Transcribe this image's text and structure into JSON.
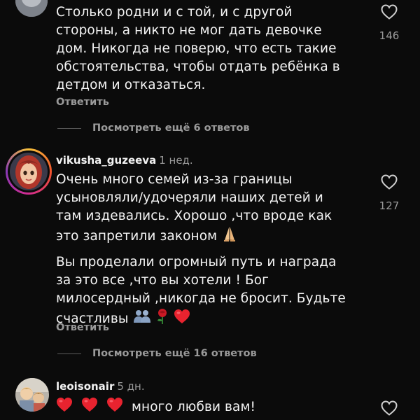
{
  "comments": [
    {
      "lines": [
        "Столько родни и с той, и с другой",
        "стороны, а никто не мог дать девочке",
        "дом. Никогда не поверю, что есть такие",
        "обстоятельства, чтобы отдать ребёнка в",
        "детдом и отказаться."
      ],
      "reply_label": "Ответить",
      "view_replies": "Посмотреть ещё 6 ответов",
      "likes": "146"
    },
    {
      "username": "vikusha_guzeeva",
      "time": "1 нед.",
      "lines": [
        "Очень много семей из-за границы",
        "усыновляли/удочеряли наших детей и",
        "там издевались. Хорошо ,что вроде как",
        "это запретили законом",
        "Вы проделали огромный путь и награда",
        "за это все ,что вы хотели ! Бог",
        "милосердный ,никогда не бросит. Будьте",
        "счастливы"
      ],
      "reply_label": "Ответить",
      "view_replies": "Посмотреть ещё 16 ответов",
      "likes": "127"
    },
    {
      "username": "leoisonair",
      "time": "5 дн.",
      "text": "много любви вам!"
    }
  ],
  "icons": {
    "heart_outline": "heart-outline-icon",
    "heart_red": "red-heart-emoji",
    "pray": "folded-hands-emoji",
    "rose": "rose-emoji",
    "couple": "couple-emoji"
  },
  "colors": {
    "background": "#0b0b0b",
    "text": "#f4f4f4",
    "muted": "#9a9a9a",
    "heart_red": "#e8232f"
  }
}
